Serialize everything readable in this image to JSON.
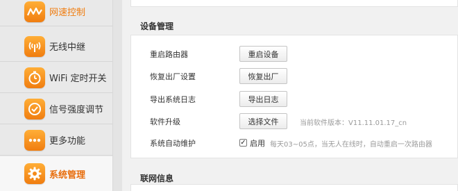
{
  "sidebar": {
    "items": [
      {
        "label": "网速控制",
        "icon": "speed-chart-icon"
      },
      {
        "label": "无线中继",
        "icon": "wireless-repeater-icon"
      },
      {
        "label": "WiFi 定时开关",
        "icon": "wifi-timer-icon"
      },
      {
        "label": "信号强度调节",
        "icon": "signal-strength-icon"
      },
      {
        "label": "更多功能",
        "icon": "more-dots-icon"
      },
      {
        "label": "系统管理",
        "icon": "gear-icon"
      }
    ]
  },
  "device_management": {
    "title": "设备管理",
    "rows": [
      {
        "label": "重启路由器",
        "button": "重启设备"
      },
      {
        "label": "恢复出厂设置",
        "button": "恢复出厂"
      },
      {
        "label": "导出系统日志",
        "button": "导出日志"
      },
      {
        "label": "软件升级",
        "button": "选择文件",
        "note": "当前软件版本：V11.11.01.17_cn"
      }
    ],
    "auto_maintenance": {
      "label": "系统自动维护",
      "checkbox_label": "启用",
      "checked": true,
      "note": "每天03~05点，当无人在线时，自动重启一次路由器"
    }
  },
  "network_info": {
    "title": "联网信息"
  },
  "colors": {
    "accent": "#f07d10",
    "icon_gradient_top": "#ffae37",
    "icon_gradient_bottom": "#f07d10"
  }
}
